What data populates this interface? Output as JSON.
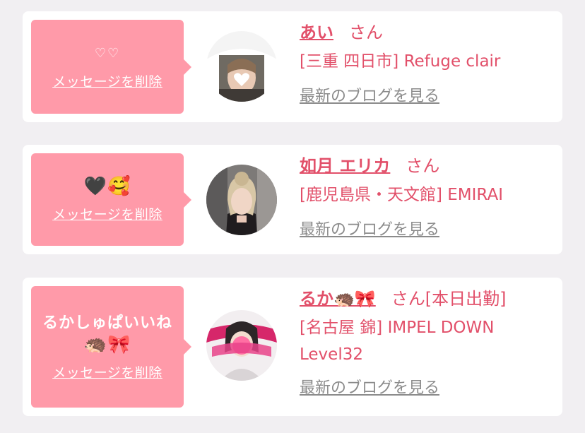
{
  "cards": [
    {
      "message": "♡♡",
      "delete_label": "メッセージを削除",
      "name": "あい",
      "honorific": "さん",
      "status": "",
      "shop": "[三重 四日市] Refuge clair",
      "blog_link": "最新のブログを見る"
    },
    {
      "message": "🖤🥰",
      "delete_label": "メッセージを削除",
      "name": "如月 エリカ",
      "honorific": "さん",
      "status": "",
      "shop": "[鹿児島県・天文館] EMIRAI",
      "blog_link": "最新のブログを見る"
    },
    {
      "message_line1": "るかしゅぱいいね",
      "message_line2": "🦔🎀",
      "delete_label": "メッセージを削除",
      "name": "るか🦔🎀",
      "honorific": "さん",
      "status": "[本日出勤]",
      "shop": "[名古屋 錦] IMPEL DOWN Level32",
      "blog_link": "最新のブログを見る"
    }
  ],
  "colors": {
    "page_bg": "#f1eff2",
    "card_bg": "#ffffff",
    "bubble_bg": "#ff9aa9",
    "accent_text": "#e2506a",
    "link_gray": "#8b8b8b"
  }
}
